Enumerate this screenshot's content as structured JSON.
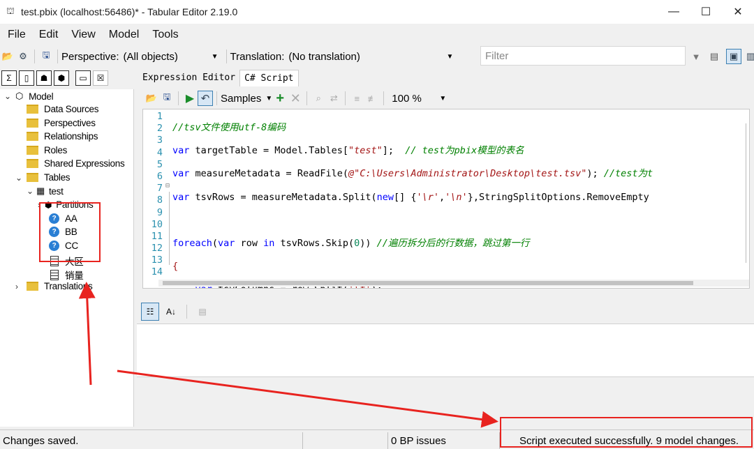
{
  "window": {
    "title": "test.pbix (localhost:56486)* - Tabular Editor 2.19.0",
    "minimize": "—",
    "maximize": "☐",
    "close": "✕"
  },
  "menu": [
    "File",
    "Edit",
    "View",
    "Model",
    "Tools"
  ],
  "toolbar": {
    "perspective_label": "Perspective:",
    "perspective_value": "(All objects)",
    "translation_label": "Translation:",
    "translation_value": "(No translation)",
    "filter_placeholder": "Filter"
  },
  "tree": {
    "model": "Model",
    "data_sources": "Data Sources",
    "perspectives": "Perspectives",
    "relationships": "Relationships",
    "roles": "Roles",
    "shared_expressions": "Shared Expressions",
    "tables": "Tables",
    "test": "test",
    "partitions": "Partitions",
    "measures": [
      "AA",
      "BB",
      "CC"
    ],
    "columns": [
      "大区",
      "销量"
    ],
    "translations": "Translations"
  },
  "tabs": [
    "Expression Editor",
    "C# Script"
  ],
  "editor_toolbar": {
    "samples": "Samples",
    "zoom": "100 %"
  },
  "code_lines": [
    "1",
    "2",
    "3",
    "4",
    "5",
    "6",
    "7",
    "8",
    "9",
    "10",
    "11",
    "12",
    "13",
    "14"
  ],
  "status": {
    "left": "Changes saved.",
    "bp": "0 BP issues",
    "right": "Script executed successfully. 9 model changes."
  },
  "colors": {
    "annotation_red": "#e8231f",
    "keyword": "#0000ff",
    "comment": "#008000",
    "string": "#a31515",
    "line_number": "#2b91af"
  }
}
